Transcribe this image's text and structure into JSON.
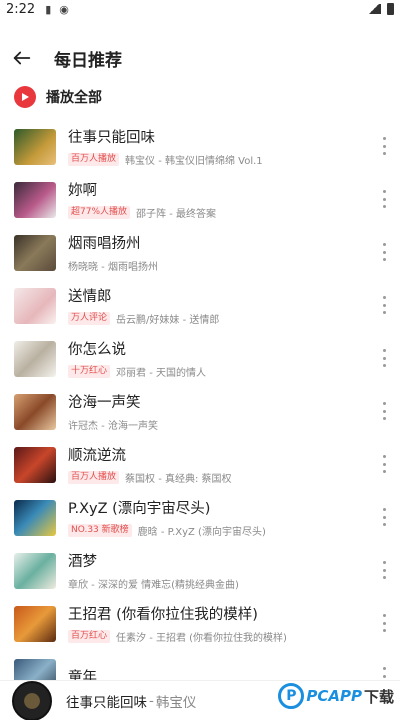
{
  "status_bar": {
    "time": "2:22"
  },
  "header": {
    "title": "每日推荐",
    "back_icon": "arrow-left-icon"
  },
  "play_all": {
    "label": "播放全部",
    "icon": "play-circle-icon",
    "accent": "#e8383d"
  },
  "songs": [
    {
      "title": "往事只能回味",
      "tag": "百万人播放",
      "meta": "韩宝仪 - 韩宝仪旧情绵绵 Vol.1",
      "cover": "linear-gradient(135deg,#2d5a2a,#c49a3a 60%,#e8c07a)"
    },
    {
      "title": "妳啊",
      "tag": "超77%人播放",
      "meta": "邵子阵 - 最终答案",
      "cover": "linear-gradient(135deg,#3a2a3a,#b85a8a 55%,#eaeaea)"
    },
    {
      "title": "烟雨唱扬州",
      "tag": "",
      "meta": "杨晓晓 - 烟雨唱扬州",
      "cover": "linear-gradient(135deg,#3a3228,#8a7a5a 50%,#5a4a3a)"
    },
    {
      "title": "送情郎",
      "tag": "万人评论",
      "meta": "岳云鹏/好妹妹 - 送情郎",
      "cover": "linear-gradient(135deg,#f5e8e8,#e6b7bb 60%,#faf2f0)"
    },
    {
      "title": "你怎么说",
      "tag": "十万红心",
      "meta": "邓丽君 - 天国的情人",
      "cover": "linear-gradient(135deg,#f0eee8,#b9b0a0 50%,#f5f3ee)"
    },
    {
      "title": "沧海一声笑",
      "tag": "",
      "meta": "许冠杰 - 沧海一声笑",
      "cover": "linear-gradient(135deg,#d6a070,#8a4a2a 50%,#e8c8a0)"
    },
    {
      "title": "顺流逆流",
      "tag": "百万人播放",
      "meta": "蔡国权 - 真经典: 蔡国权",
      "cover": "linear-gradient(135deg,#5a1818,#c8462a 50%,#2a1010)"
    },
    {
      "title": "P.XyZ (漂向宇宙尽头)",
      "tag": "NO.33 新歌榜",
      "meta": "鹿晗 - P.XyZ (漂向宇宙尽头)",
      "cover": "linear-gradient(135deg,#0a2a4a,#3a8ab8 45%,#e8c840)"
    },
    {
      "title": "酒梦",
      "tag": "",
      "meta": "章欣 - 深深的爱 情难忘(精挑经典金曲)",
      "cover": "linear-gradient(135deg,#e8f0ea,#6ab0a0 50%,#f0ece0)"
    },
    {
      "title": "王招君 (你看你拉住我的模样)",
      "tag": "百万红心",
      "meta": "任素汐 - 王招君 (你看你拉住我的模样)",
      "cover": "linear-gradient(135deg,#c8581a,#e89a3a 50%,#5a2a10)"
    },
    {
      "title": "童年",
      "tag": "",
      "meta": "",
      "cover": "linear-gradient(135deg,#3a5a7a,#8ab0c8 50%,#2a3a4a)"
    }
  ],
  "now_playing": {
    "title": "往事只能回味",
    "separator": "-",
    "artist": "韩宝仪"
  },
  "watermark": {
    "letter": "P",
    "brand": "PCAPP",
    "suffix": "下载"
  },
  "more_icon": "more-vertical-icon"
}
